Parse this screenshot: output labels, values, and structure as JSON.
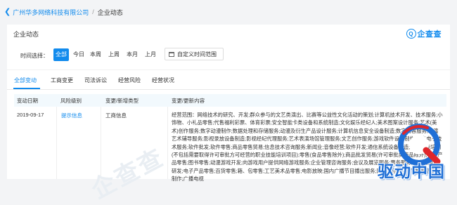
{
  "breadcrumb": {
    "company": "广州华多网络科技有限公司",
    "separator": "/",
    "current": "企业动态"
  },
  "header": {
    "title": "企业动态",
    "logo_text": "企查查",
    "logo_mark": "Q"
  },
  "filter": {
    "label": "时间选择：",
    "options": [
      "全部",
      "今日",
      "本周",
      "上周",
      "本月",
      "上月"
    ],
    "active": "全部",
    "custom_range_label": "自定义时间范围"
  },
  "tabs": {
    "items": [
      "全部变动",
      "工商变更",
      "司法诉讼",
      "经营风险",
      "经营状况"
    ],
    "active": "全部变动"
  },
  "table": {
    "columns": [
      "变动日期",
      "风险级别",
      "变更/新增类型",
      "变更/更新内容"
    ],
    "rows": [
      {
        "date": "2019-09-17",
        "risk": "提示信息",
        "type": "工商信息",
        "content": "经营范围：网络技术的研究、开发;群众参与的文艺类演出、比赛等公益性文化活动的策划;计算机技术开发、技术服务;小饰物、小礼品零售;代售福利彩票、体育彩票;安全智能卡类设备和系统制造;文化娱乐经纪人;美术图案设计服务;艺术(美术)创作服务;数字动漫制作;数据处理和存储服务;动漫及衍生产品设计服务;计算机信息安全设备制造;数字内容服务;表演艺术辅导服务;影视录放设备制造;影视经纪代理服务;艺术表演场馆管理服务;文艺创作服务;游戏软件设计制作;信息电子技术服务;软件批发;软件零售;商品零售贸易;信息技术咨询服务;新闻业;音像经营;软件开发;通信系统设备制造;职业技能培训(不包括需要取得许可审批方可经营的职业技能培训项目);零售(食品零售除外);商品批发贸易(许可审批类商品除外);电子产品零售;图书零售;动漫游戏开发;向游戏用户提供网络游戏服务;企业管理咨询服务;会议及展览服务;票务服务;动漫及游戏研发;电子产品零售;百货零售;箱、包零售;工艺美术品零售;电影放映;国内广播节目播出服务;网络音乐服务;广播电视节目制作;广播电视"
      }
    ]
  },
  "watermark": "企查查",
  "overlay_logo": {
    "text": "驱动中国"
  },
  "colors": {
    "accent": "#128bed",
    "page_bg": "#f3f4f6",
    "table_header_bg": "#f2f9fd",
    "overlay_blue": "#1f6fd6",
    "overlay_red": "#e0262b"
  }
}
